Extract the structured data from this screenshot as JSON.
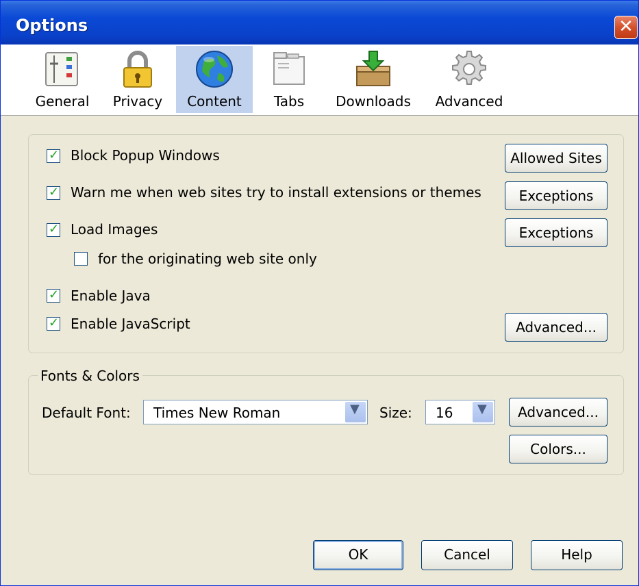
{
  "window": {
    "title": "Options",
    "close_glyph": "✕"
  },
  "tabs": [
    {
      "label": "General",
      "icon": "general-settings-icon"
    },
    {
      "label": "Privacy",
      "icon": "padlock-icon"
    },
    {
      "label": "Content",
      "icon": "globe-icon",
      "selected": true
    },
    {
      "label": "Tabs",
      "icon": "tabs-icon"
    },
    {
      "label": "Downloads",
      "icon": "download-box-icon"
    },
    {
      "label": "Advanced",
      "icon": "gear-icon"
    }
  ],
  "content": {
    "block_popups": {
      "label": "Block Popup Windows",
      "checked": true,
      "button": "Allowed Sites"
    },
    "warn_extensions": {
      "label": "Warn me when web sites try to install extensions or themes",
      "checked": true,
      "button": "Exceptions"
    },
    "load_images": {
      "label": "Load Images",
      "checked": true,
      "button": "Exceptions"
    },
    "originating_only": {
      "label": "for the originating web site only",
      "checked": false
    },
    "enable_java": {
      "label": "Enable Java",
      "checked": true
    },
    "enable_javascript": {
      "label": "Enable JavaScript",
      "checked": true,
      "button": "Advanced..."
    }
  },
  "fonts": {
    "legend": "Fonts & Colors",
    "default_font_label": "Default Font:",
    "default_font_value": "Times New Roman",
    "size_label": "Size:",
    "size_value": "16",
    "advanced_button": "Advanced...",
    "colors_button": "Colors..."
  },
  "footer": {
    "ok": "OK",
    "cancel": "Cancel",
    "help": "Help"
  },
  "colors": {
    "titlebar": "#0a49d6",
    "selected_tab": "#c1d2ee",
    "dialog_bg": "#ece9d8",
    "check": "#21a121"
  }
}
